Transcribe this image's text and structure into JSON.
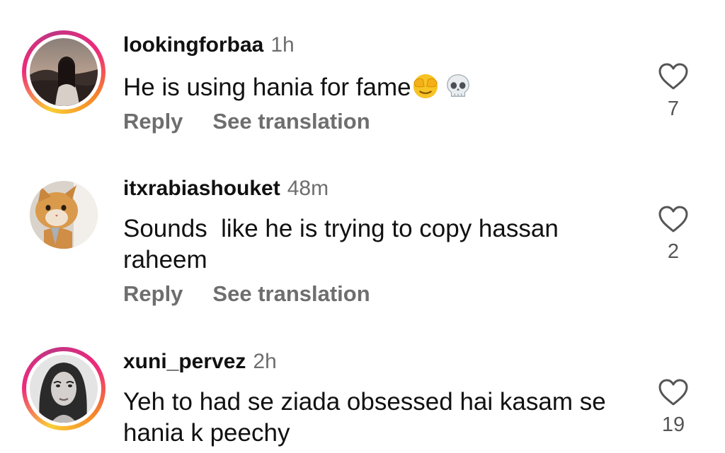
{
  "comments": [
    {
      "username": "lookingforbaa",
      "time": "1h",
      "text": "He is using hania for fame",
      "emojis": [
        "face-with-hand-over-eyes-emoji",
        "skull-emoji"
      ],
      "reply_label": "Reply",
      "translate_label": "See translation",
      "like_count": "7",
      "has_story_ring": true
    },
    {
      "username": "itxrabiashouket",
      "time": "48m",
      "text": "Sounds  like he is trying to copy hassan raheem",
      "reply_label": "Reply",
      "translate_label": "See translation",
      "like_count": "2",
      "has_story_ring": false
    },
    {
      "username": "xuni_pervez",
      "time": "2h",
      "text": "Yeh to had se ziada obsessed hai kasam se hania k peechy",
      "like_count": "19",
      "has_story_ring": true
    }
  ],
  "icons": {
    "like": "heart-outline-icon"
  },
  "colors": {
    "text": "#111111",
    "muted": "#6e6e6e",
    "story_ring": [
      "#f9ce34",
      "#ee2a7b",
      "#c13584"
    ]
  }
}
